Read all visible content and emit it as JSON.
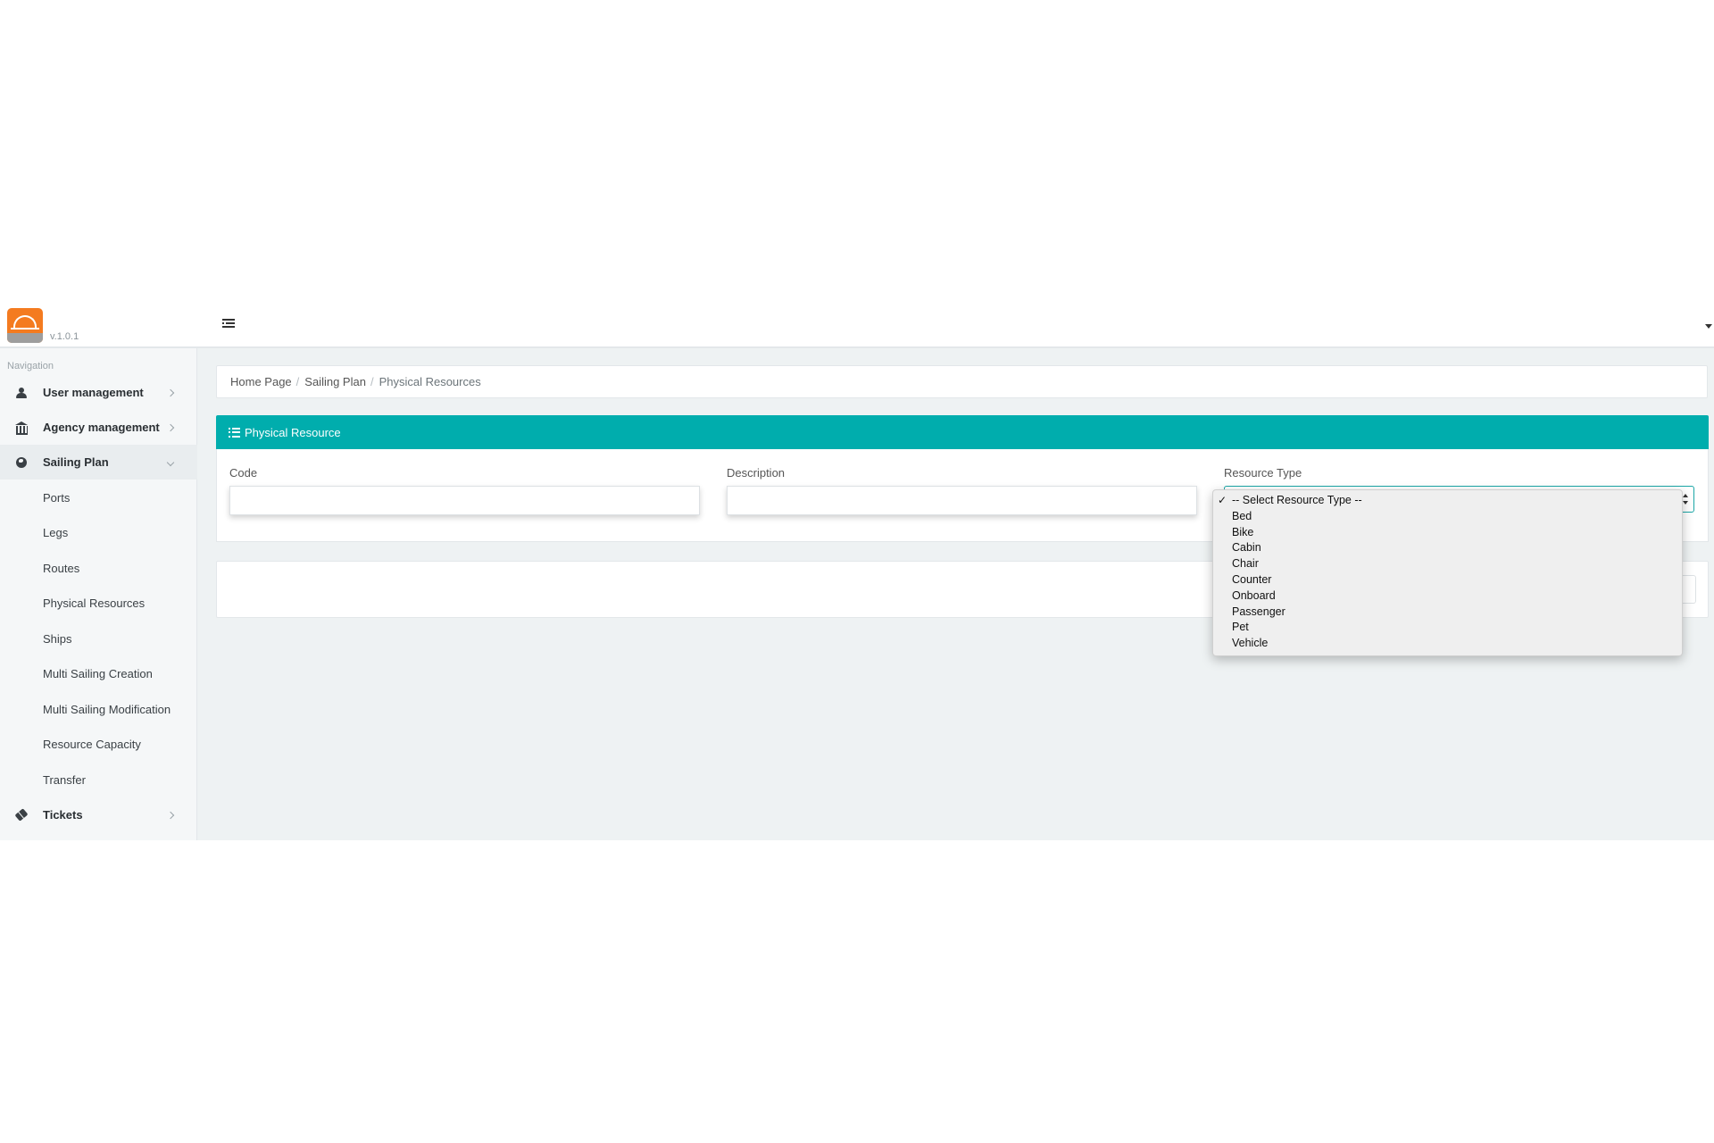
{
  "app": {
    "version": "v.1.0.1"
  },
  "sidebar": {
    "heading": "Navigation",
    "groups": [
      {
        "label": "User management"
      },
      {
        "label": "Agency management"
      },
      {
        "label": "Sailing Plan"
      },
      {
        "label": "Tickets"
      }
    ],
    "sailing_plan_items": [
      {
        "label": "Ports"
      },
      {
        "label": "Legs"
      },
      {
        "label": "Routes"
      },
      {
        "label": "Physical Resources"
      },
      {
        "label": "Ships"
      },
      {
        "label": "Multi Sailing Creation"
      },
      {
        "label": "Multi Sailing Modification"
      },
      {
        "label": "Resource Capacity"
      },
      {
        "label": "Transfer"
      }
    ]
  },
  "breadcrumb": {
    "items": [
      "Home Page",
      "Sailing Plan",
      "Physical Resources"
    ],
    "separator": "/"
  },
  "panel": {
    "title": "Physical Resource",
    "header_color": "#00adad"
  },
  "form": {
    "code": {
      "label": "Code",
      "value": ""
    },
    "description": {
      "label": "Description",
      "value": ""
    },
    "resource_type": {
      "label": "Resource Type",
      "selected": "-- Select Resource Type --",
      "options": [
        "-- Select Resource Type --",
        "Bed",
        "Bike",
        "Cabin",
        "Chair",
        "Counter",
        "Onboard",
        "Passenger",
        "Pet",
        "Vehicle"
      ]
    }
  },
  "icons": {
    "toggle": "menu-toggle-icon",
    "user": "user-icon",
    "agency": "bank-icon",
    "sailing": "globe-icon",
    "tickets": "ticket-icon",
    "panel": "list-icon",
    "check": "✓"
  }
}
